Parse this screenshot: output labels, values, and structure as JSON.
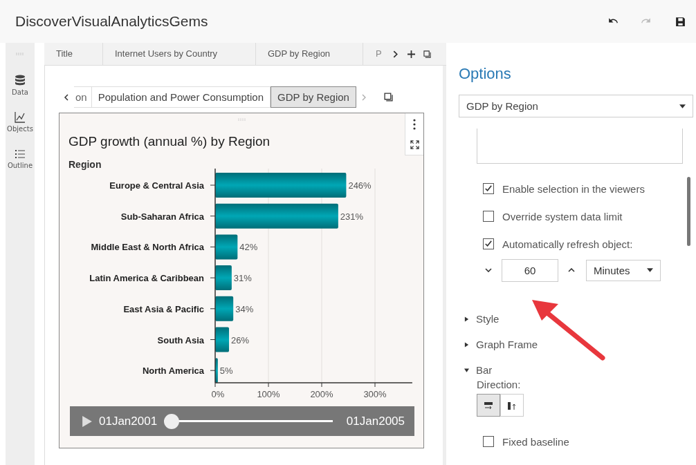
{
  "window": {
    "title": "DiscoverVisualAnalyticsGems"
  },
  "toolbar": [
    {
      "kind": "undo",
      "disabled": false
    },
    {
      "kind": "redo",
      "disabled": true
    },
    {
      "kind": "save",
      "disabled": false
    }
  ],
  "sidebar": {
    "items": [
      {
        "label": "Data",
        "kind": "data"
      },
      {
        "label": "Objects",
        "kind": "objects"
      },
      {
        "label": "Outline",
        "kind": "outline"
      }
    ]
  },
  "page_tabs": [
    "Title",
    "Internet Users by Country",
    "GDP by Region",
    "P"
  ],
  "inner_tabs": [
    {
      "label": "on",
      "selected": false
    },
    {
      "label": "Population and Power Consumption",
      "selected": false
    },
    {
      "label": "GDP by Region",
      "selected": true
    }
  ],
  "chart": {
    "chart_data": {
      "type": "bar",
      "orientation": "horizontal",
      "title": "GDP growth (annual %) by Region",
      "ylabel": "Region",
      "categories": [
        "Europe & Central Asia",
        "Sub-Saharan Africa",
        "Middle East & North Africa",
        "Latin America & Caribbean",
        "East Asia & Pacific",
        "South Asia",
        "North America"
      ],
      "values": [
        246,
        231,
        42,
        31,
        34,
        26,
        5
      ],
      "value_labels": [
        "246%",
        "231%",
        "42%",
        "31%",
        "34%",
        "26%",
        "5%"
      ],
      "xlim": [
        0,
        370
      ],
      "grid": true,
      "xticks": [
        {
          "value": 0,
          "label": "0%"
        },
        {
          "value": 100,
          "label": "100%"
        },
        {
          "value": 200,
          "label": "200%"
        },
        {
          "value": 300,
          "label": "300%"
        }
      ]
    }
  },
  "player": {
    "start": "01Jan2001",
    "end": "01Jan2005",
    "level": 0
  },
  "options": {
    "title": "Options",
    "object_select": "GDP by Region",
    "checkboxes": [
      {
        "label": "Enable selection in the viewers",
        "checked": true
      },
      {
        "label": "Override system data limit",
        "checked": false
      },
      {
        "label": "Automatically refresh object:",
        "checked": true
      }
    ],
    "refresh": {
      "value": "60",
      "unit": "Minutes"
    },
    "sections": [
      {
        "label": "Style",
        "expanded": false
      },
      {
        "label": "Graph Frame",
        "expanded": false
      },
      {
        "label": "Bar",
        "expanded": true
      }
    ],
    "direction": {
      "label": "Direction:",
      "options": [
        {
          "kind": "horizontal",
          "selected": true
        },
        {
          "kind": "vertical",
          "selected": false
        }
      ]
    },
    "fixed_baseline": {
      "label": "Fixed baseline",
      "checked": false
    }
  }
}
